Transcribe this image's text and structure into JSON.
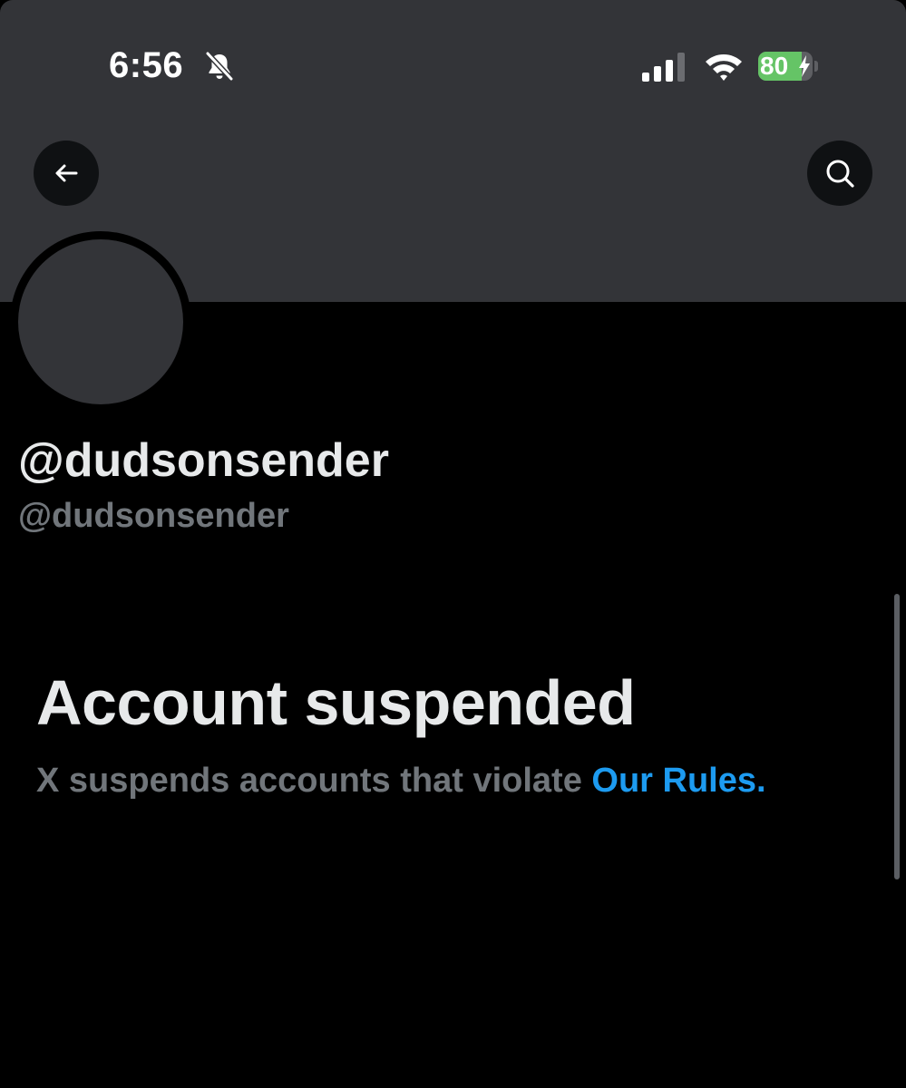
{
  "status_bar": {
    "time": "6:56",
    "battery_level": "80",
    "battery_fraction": 0.8,
    "icons": [
      "bell-slash-icon",
      "cellular-signal-icon",
      "wifi-icon",
      "battery-charging-icon"
    ]
  },
  "nav": {
    "back_icon": "arrow-left-icon",
    "search_icon": "search-icon"
  },
  "profile": {
    "display_name": "@dudsonsender",
    "handle": "@dudsonsender"
  },
  "suspension": {
    "title": "Account suspended",
    "description": "X suspends accounts that violate ",
    "rules_link": "Our Rules",
    "period": "."
  },
  "colors": {
    "background": "#000000",
    "banner": "#333438",
    "primary_text": "#e7e9ea",
    "secondary_text": "#71767b",
    "link": "#1d9bf0",
    "battery_green": "#65c466"
  }
}
